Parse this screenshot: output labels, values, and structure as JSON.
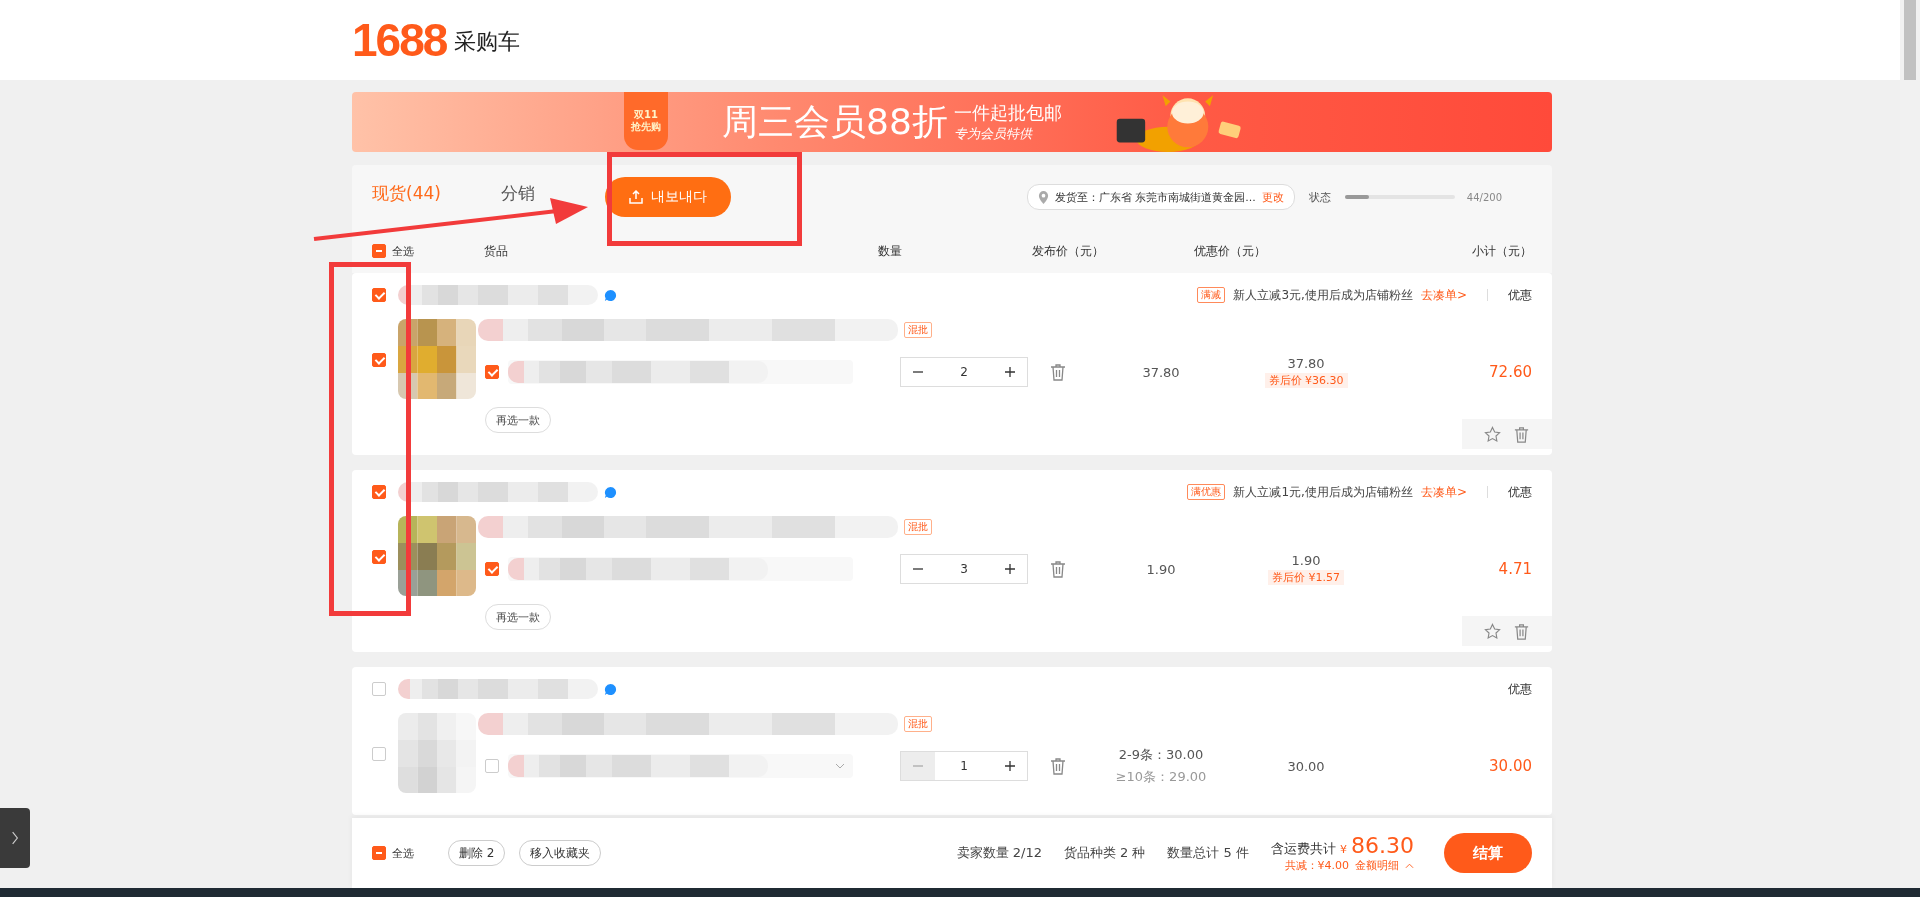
{
  "header": {
    "logo": "1688",
    "title": "采购车"
  },
  "banner": {
    "badge_top": "双11",
    "badge_bottom": "抢先购",
    "headline": "周三会员88折",
    "subline": "一件起批包邮",
    "note": "专为会员特供"
  },
  "tabs": [
    {
      "label": "现货(44)",
      "selected": true
    },
    {
      "label": "分销",
      "selected": false
    }
  ],
  "export_button": "내보내다",
  "ship_to": {
    "label": "发货至：",
    "address": "广东省 东莞市南城街道黄金园...",
    "action": "更改"
  },
  "status": {
    "label": "状态",
    "level": 0.22,
    "reading": "44/200"
  },
  "select_all": {
    "label": "全选",
    "indeterminate": true
  },
  "columns": [
    "货品",
    "数量",
    "发布价（元）",
    "优惠价（元）",
    "小计（元）"
  ],
  "items": [
    {
      "shop_checked": true,
      "promo": {
        "tag": "满减",
        "text": "新人立减3元,使用后成为店铺粉丝",
        "link": "去凑单>"
      },
      "discount_label": "优惠",
      "product_checked": true,
      "tag": "混批",
      "sku_checked": true,
      "sku_dropdown": false,
      "quantity": "2",
      "minus_disabled": false,
      "prices": [
        {
          "text": "37.80",
          "muted": false
        }
      ],
      "discount_price": "37.80",
      "coupon_price": "券后价 ¥36.30",
      "subtotal": "72.60",
      "reselect": "再选一款"
    },
    {
      "shop_checked": true,
      "promo": {
        "tag": "满优惠",
        "text": "新人立减1元,使用后成为店铺粉丝",
        "link": "去凑单>"
      },
      "discount_label": "优惠",
      "product_checked": true,
      "tag": "混批",
      "sku_checked": true,
      "sku_dropdown": false,
      "quantity": "3",
      "minus_disabled": false,
      "prices": [
        {
          "text": "1.90",
          "muted": false
        }
      ],
      "discount_price": "1.90",
      "coupon_price": "券后价 ¥1.57",
      "subtotal": "4.71",
      "reselect": "再选一款"
    },
    {
      "shop_checked": false,
      "discount_label": "优惠",
      "product_checked": false,
      "tag": "混批",
      "sku_checked": false,
      "sku_dropdown": true,
      "quantity": "1",
      "minus_disabled": true,
      "prices": [
        {
          "text": "2-9条：30.00",
          "muted": false
        },
        {
          "text": "≥10条：29.00",
          "muted": true
        }
      ],
      "discount_price": "30.00",
      "subtotal": "30.00"
    }
  ],
  "footer": {
    "select_all": {
      "label": "全选",
      "indeterminate": true
    },
    "buttons": [
      "删除 2",
      "移入收藏夹"
    ],
    "stats": [
      "卖家数量 2/12",
      "货品种类 2 种",
      "数量总计 5 件"
    ],
    "total_label": "含运费共计",
    "currency": "¥",
    "total": "86.30",
    "savings": "共减：¥4.00",
    "detail_link": "金额明细",
    "checkout": "结算"
  }
}
